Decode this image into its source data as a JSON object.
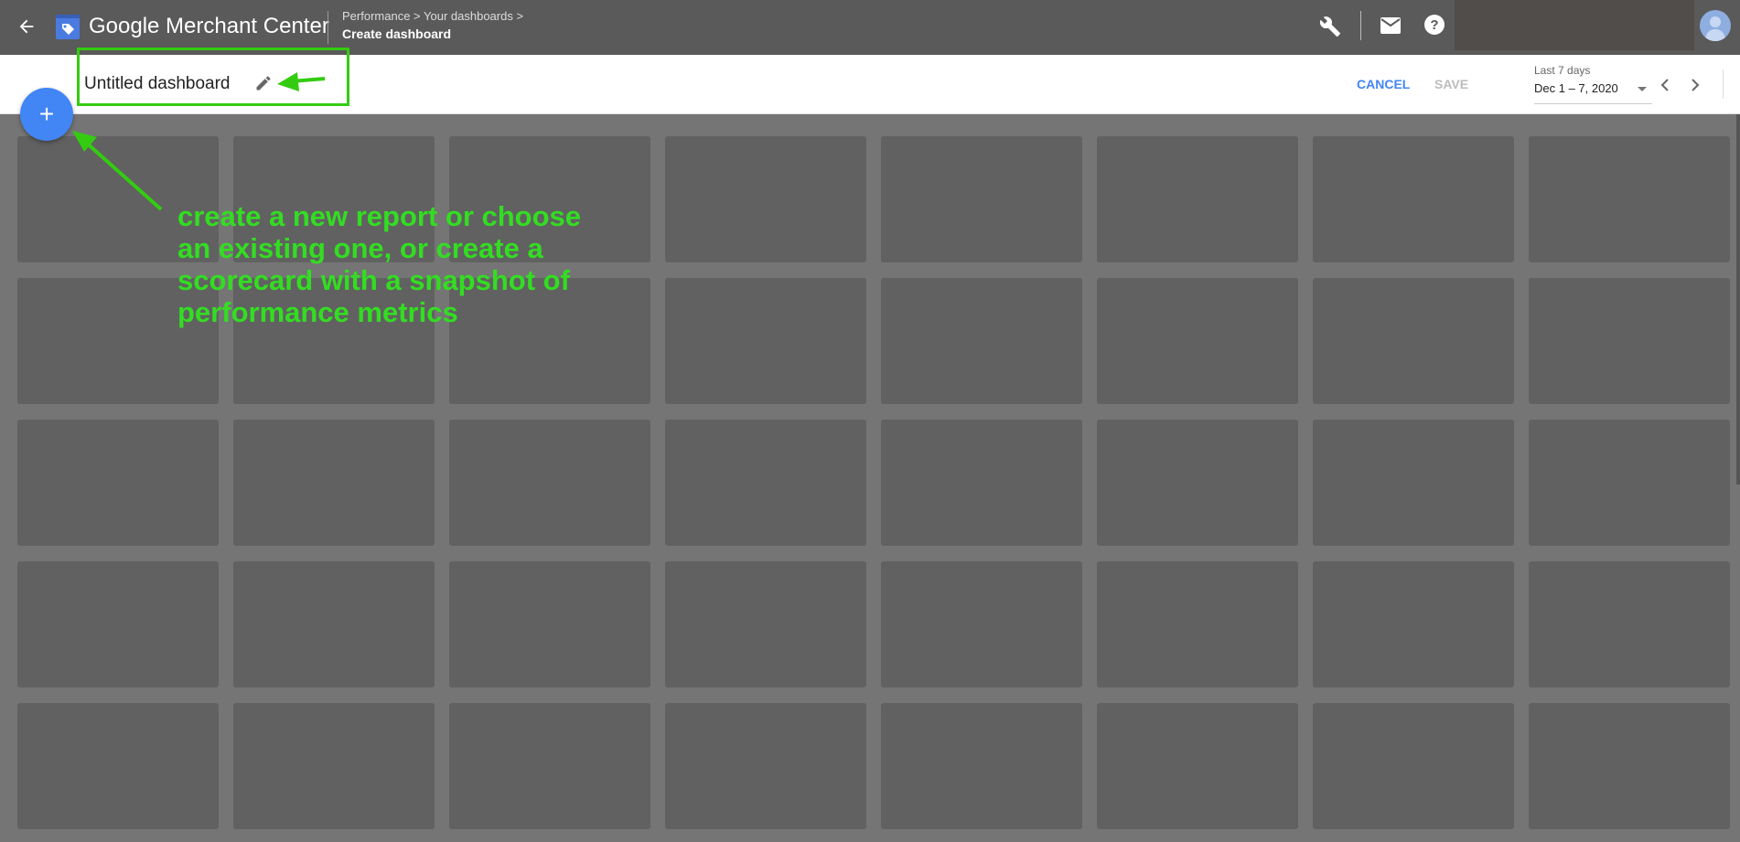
{
  "header": {
    "app_title": "Google Merchant Center",
    "breadcrumb": [
      "Performance",
      "Your dashboards"
    ],
    "page_title": "Create dashboard"
  },
  "toolbar": {
    "dashboard_title": "Untitled dashboard",
    "cancel_label": "CANCEL",
    "save_label": "SAVE",
    "date_range_label": "Last 7 days",
    "date_range_value": "Dec 1 – 7, 2020"
  },
  "annotation": {
    "text_lines": [
      "create a new report or choose",
      "an existing one, or create a",
      "scorecard with a snapshot of",
      "performance metrics"
    ],
    "color": "#33dd22"
  },
  "colors": {
    "accent": "#4285f4",
    "annotation_box": "#33cc11"
  },
  "icons": [
    "back-arrow-icon",
    "merchant-center-logo-icon",
    "wrench-icon",
    "mail-icon",
    "help-icon",
    "avatar-icon",
    "pencil-icon",
    "add-icon",
    "dropdown-icon",
    "chevron-left-icon",
    "chevron-right-icon"
  ]
}
